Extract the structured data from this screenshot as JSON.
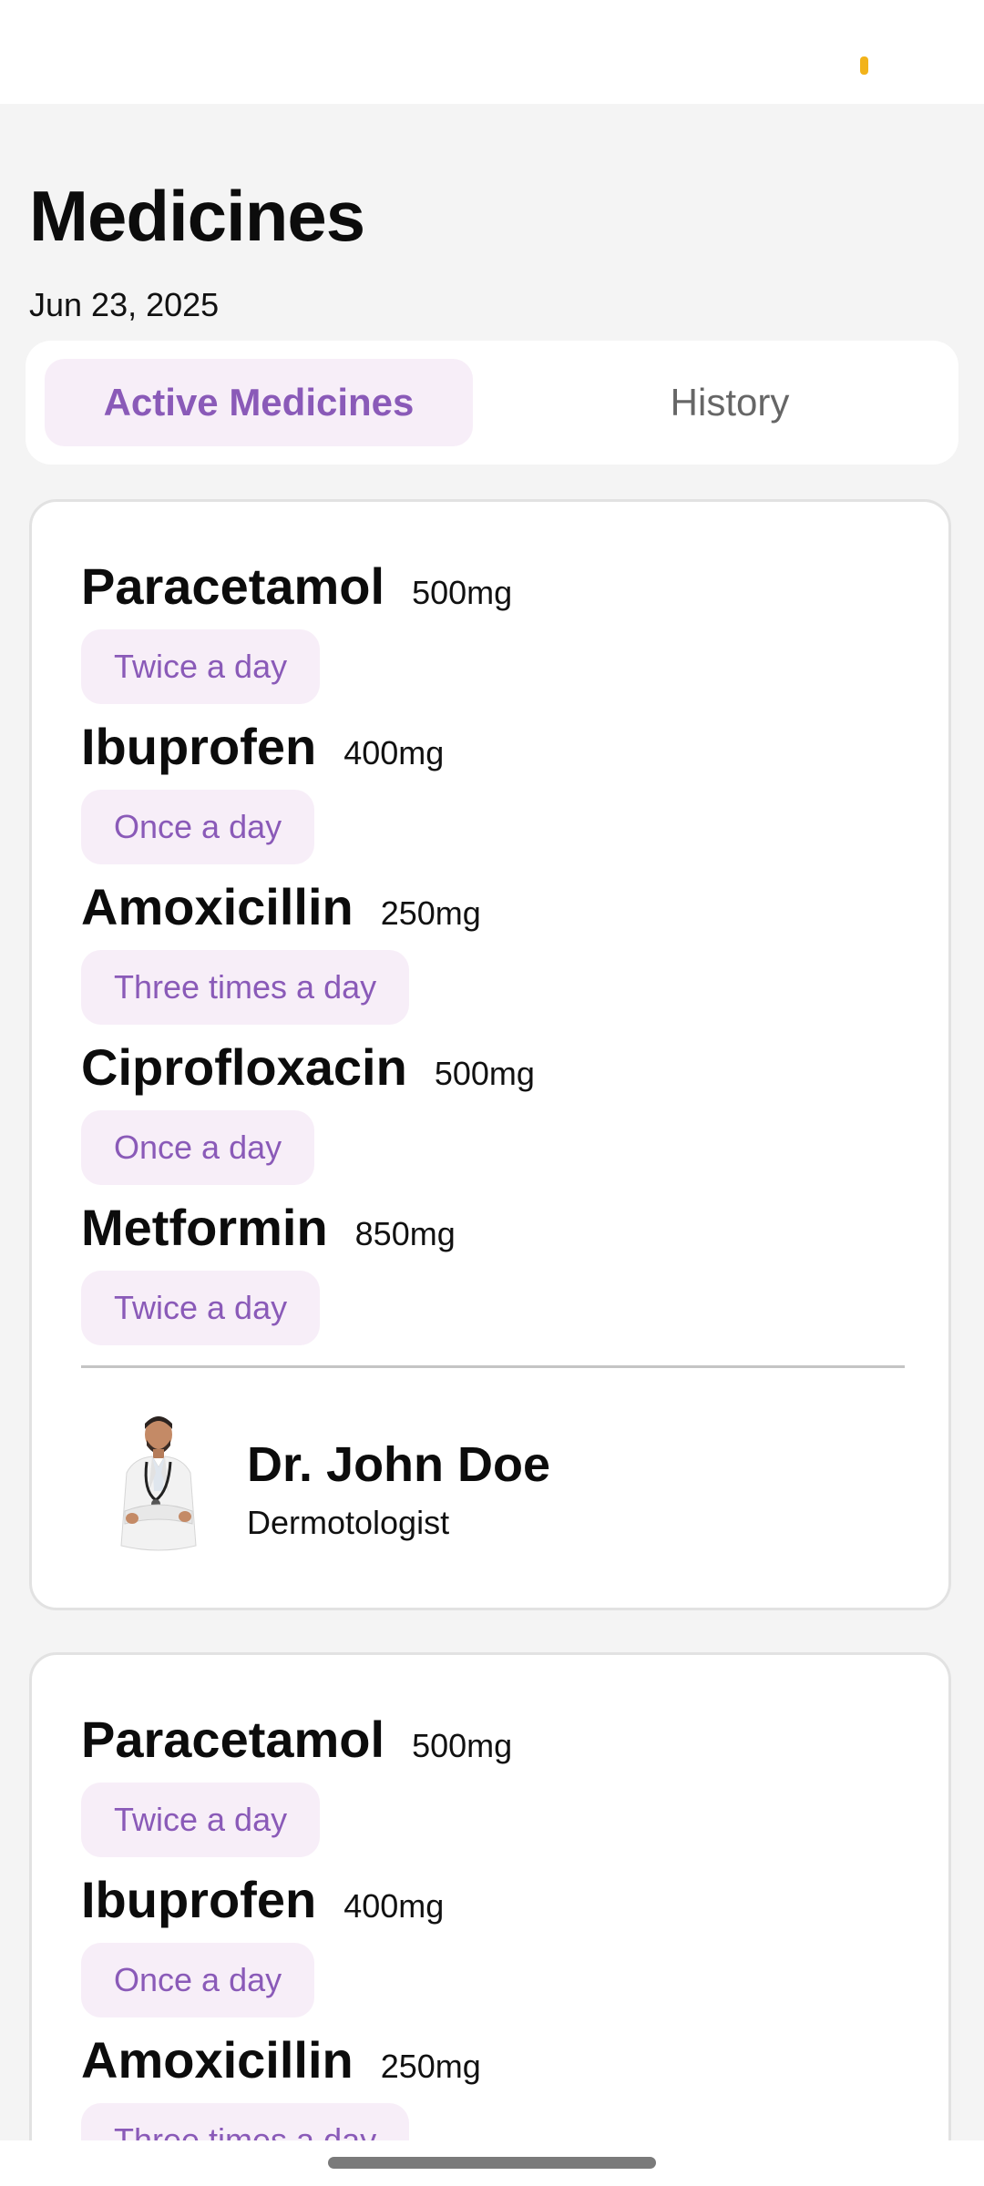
{
  "header": {
    "title": "Medicines",
    "date": "Jun 23, 2025"
  },
  "tabs": [
    {
      "label": "Active Medicines",
      "active": true
    },
    {
      "label": "History",
      "active": false
    }
  ],
  "prescriptions": [
    {
      "medicines": [
        {
          "name": "Paracetamol",
          "dose": "500mg",
          "frequency": "Twice a day"
        },
        {
          "name": "Ibuprofen",
          "dose": "400mg",
          "frequency": "Once a day"
        },
        {
          "name": "Amoxicillin",
          "dose": "250mg",
          "frequency": "Three times a day"
        },
        {
          "name": "Ciprofloxacin",
          "dose": "500mg",
          "frequency": "Once a day"
        },
        {
          "name": "Metformin",
          "dose": "850mg",
          "frequency": "Twice a day"
        }
      ],
      "doctor": {
        "name": "Dr. John Doe",
        "specialty": "Dermotologist"
      }
    },
    {
      "medicines": [
        {
          "name": "Paracetamol",
          "dose": "500mg",
          "frequency": "Twice a day"
        },
        {
          "name": "Ibuprofen",
          "dose": "400mg",
          "frequency": "Once a day"
        },
        {
          "name": "Amoxicillin",
          "dose": "250mg",
          "frequency": "Three times a day"
        }
      ]
    }
  ],
  "colors": {
    "accent": "#8a5ab8",
    "chip_background": "#f7eef8",
    "page_background": "#f4f4f4",
    "status_indicator": "#f2b31a"
  }
}
